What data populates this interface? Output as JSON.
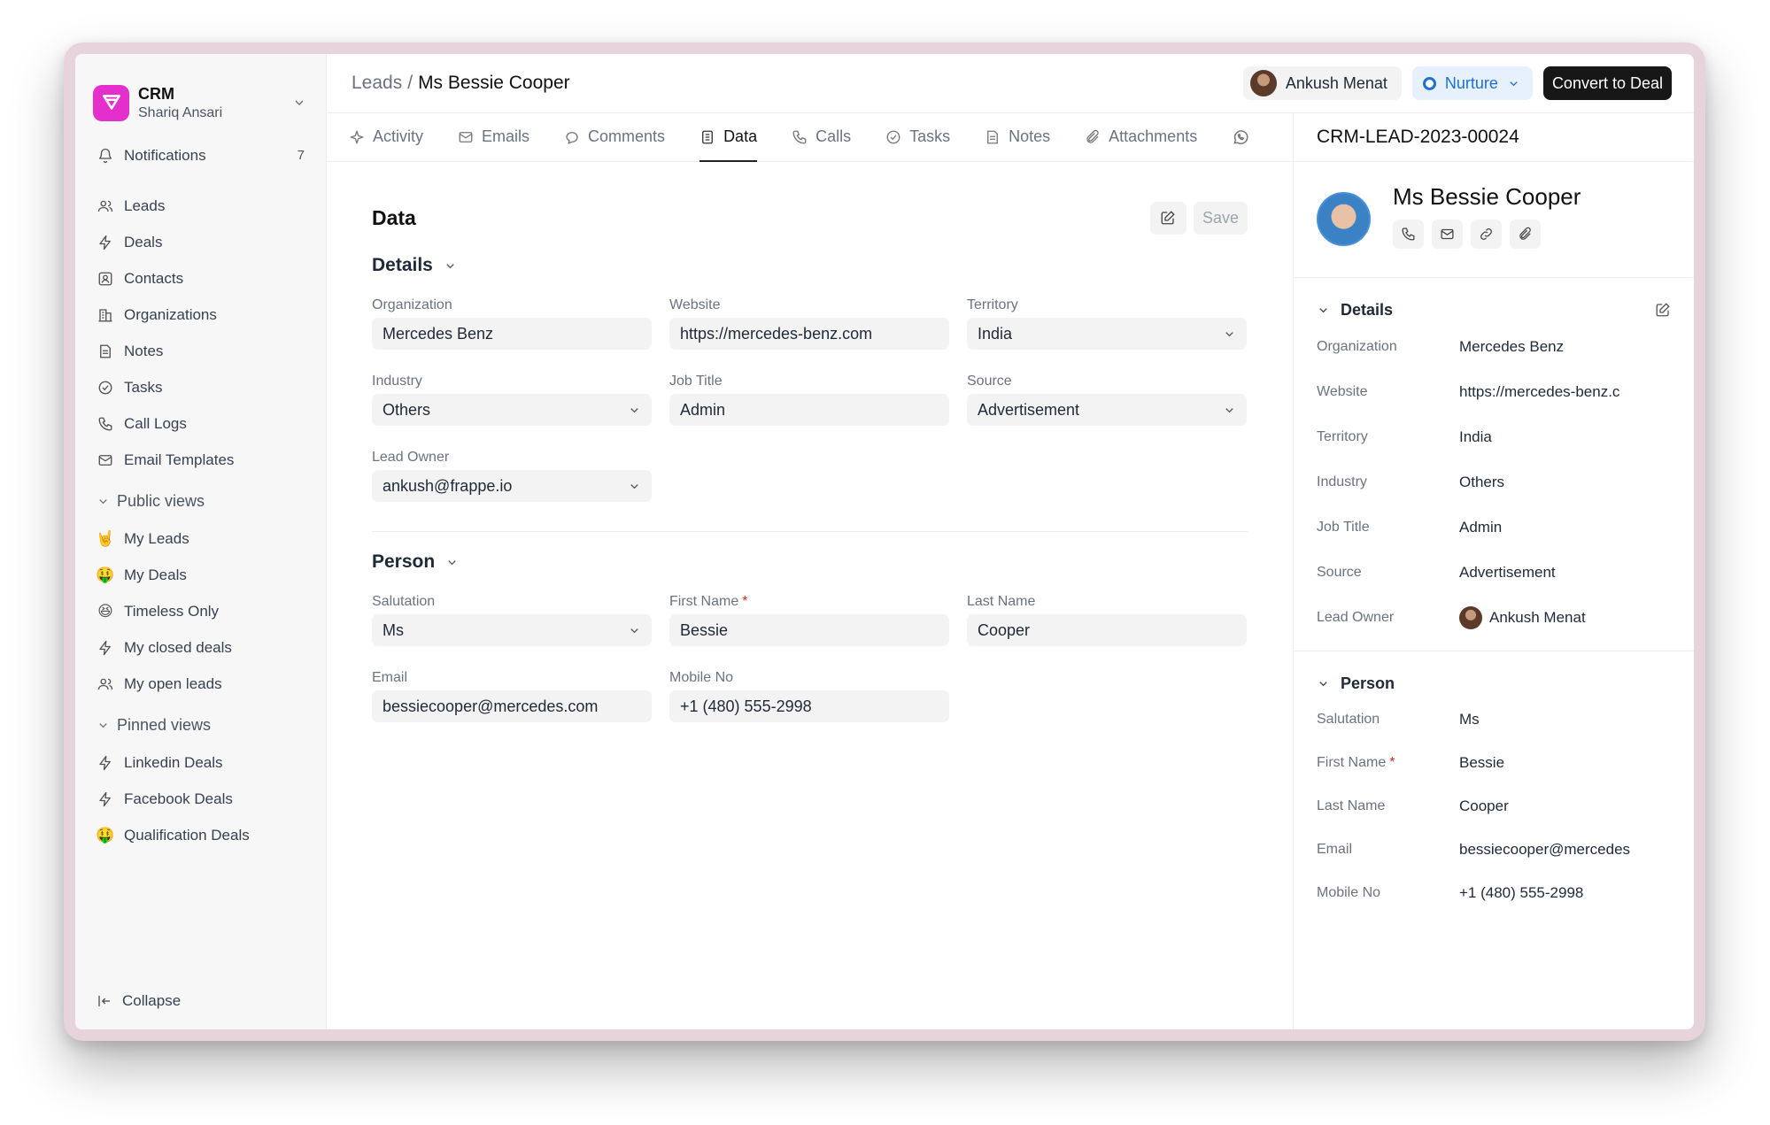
{
  "brand": {
    "name": "CRM",
    "user": "Shariq Ansari"
  },
  "sidebar": {
    "notifications": {
      "label": "Notifications",
      "count": "7"
    },
    "items": [
      {
        "label": "Leads",
        "icon": "users-icon"
      },
      {
        "label": "Deals",
        "icon": "bolt-icon"
      },
      {
        "label": "Contacts",
        "icon": "contact-icon"
      },
      {
        "label": "Organizations",
        "icon": "building-icon"
      },
      {
        "label": "Notes",
        "icon": "note-icon"
      },
      {
        "label": "Tasks",
        "icon": "check-circle-icon"
      },
      {
        "label": "Call Logs",
        "icon": "phone-icon"
      },
      {
        "label": "Email Templates",
        "icon": "mail-icon"
      }
    ],
    "public_views": {
      "title": "Public views",
      "items": [
        {
          "label": "My Leads",
          "icon": "🤘"
        },
        {
          "label": "My Deals",
          "icon": "🤑"
        },
        {
          "label": "Timeless Only",
          "icon": "😆"
        },
        {
          "label": "My closed deals",
          "icon": "bolt-icon"
        },
        {
          "label": "My open leads",
          "icon": "users-icon"
        }
      ]
    },
    "pinned_views": {
      "title": "Pinned views",
      "items": [
        {
          "label": "Linkedin Deals",
          "icon": "bolt-icon"
        },
        {
          "label": "Facebook Deals",
          "icon": "bolt-icon"
        },
        {
          "label": "Qualification Deals",
          "icon": "🤑"
        }
      ]
    },
    "collapse": "Collapse"
  },
  "header": {
    "breadcrumb_root": "Leads",
    "breadcrumb_sep": "/",
    "breadcrumb_current": "Ms Bessie Cooper",
    "owner": "Ankush Menat",
    "status": "Nurture",
    "status_color": "#1d6fd6",
    "convert_label": "Convert to Deal"
  },
  "tabs": [
    {
      "label": "Activity",
      "icon": "activity-icon"
    },
    {
      "label": "Emails",
      "icon": "mail-icon"
    },
    {
      "label": "Comments",
      "icon": "comment-icon"
    },
    {
      "label": "Data",
      "icon": "data-icon",
      "active": true
    },
    {
      "label": "Calls",
      "icon": "phone-icon"
    },
    {
      "label": "Tasks",
      "icon": "check-circle-icon"
    },
    {
      "label": "Notes",
      "icon": "note-icon"
    },
    {
      "label": "Attachments",
      "icon": "paperclip-icon"
    }
  ],
  "form": {
    "title": "Data",
    "save_label": "Save",
    "details": {
      "title": "Details",
      "organization": {
        "label": "Organization",
        "value": "Mercedes Benz"
      },
      "website": {
        "label": "Website",
        "value": "https://mercedes-benz.com"
      },
      "territory": {
        "label": "Territory",
        "value": "India"
      },
      "industry": {
        "label": "Industry",
        "value": "Others"
      },
      "job_title": {
        "label": "Job Title",
        "value": "Admin"
      },
      "source": {
        "label": "Source",
        "value": "Advertisement"
      },
      "lead_owner": {
        "label": "Lead Owner",
        "value": "ankush@frappe.io"
      }
    },
    "person": {
      "title": "Person",
      "salutation": {
        "label": "Salutation",
        "value": "Ms"
      },
      "first_name": {
        "label": "First Name",
        "required": "*",
        "value": "Bessie"
      },
      "last_name": {
        "label": "Last Name",
        "value": "Cooper"
      },
      "email": {
        "label": "Email",
        "value": "bessiecooper@mercedes.com"
      },
      "mobile": {
        "label": "Mobile No",
        "value": "+1 (480) 555-2998"
      }
    }
  },
  "right": {
    "lead_id": "CRM-LEAD-2023-00024",
    "name": "Ms Bessie Cooper",
    "details": {
      "title": "Details",
      "rows": [
        {
          "label": "Organization",
          "value": "Mercedes Benz"
        },
        {
          "label": "Website",
          "value": "https://mercedes-benz.c"
        },
        {
          "label": "Territory",
          "value": "India"
        },
        {
          "label": "Industry",
          "value": "Others"
        },
        {
          "label": "Job Title",
          "value": "Admin"
        },
        {
          "label": "Source",
          "value": "Advertisement"
        },
        {
          "label": "Lead Owner",
          "value": "Ankush Menat"
        }
      ]
    },
    "person": {
      "title": "Person",
      "rows": [
        {
          "label": "Salutation",
          "value": "Ms"
        },
        {
          "label": "First Name",
          "value": "Bessie",
          "required": "*"
        },
        {
          "label": "Last Name",
          "value": "Cooper"
        },
        {
          "label": "Email",
          "value": "bessiecooper@mercedes"
        },
        {
          "label": "Mobile No",
          "value": "+1 (480) 555-2998"
        }
      ]
    }
  }
}
